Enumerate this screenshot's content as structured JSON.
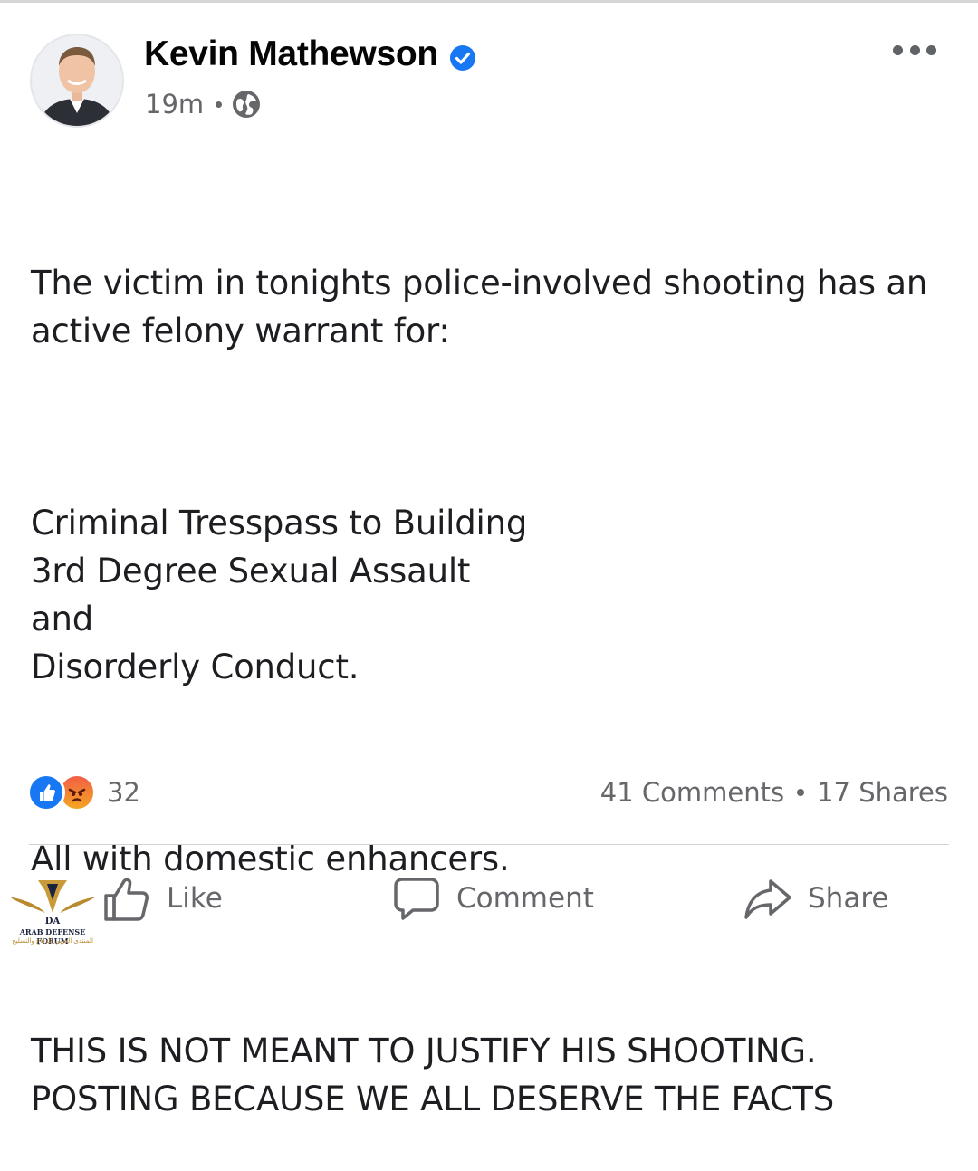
{
  "post": {
    "author_name": "Kevin Mathewson",
    "timestamp": "19m",
    "privacy_icon": "globe-icon",
    "verified_icon": "verified-badge-icon",
    "more_icon": "more-options-icon",
    "body_paragraphs": [
      "The victim in tonights police-involved shooting has an active felony warrant for:",
      "Criminal Tresspass to Building\n3rd Degree Sexual Assault\nand\nDisorderly Conduct.",
      "All with domestic enhancers.",
      "THIS IS NOT MEANT TO JUSTIFY HIS SHOOTING.\nPOSTING BECAUSE WE ALL DESERVE THE FACTS"
    ]
  },
  "engagement": {
    "reaction_icons": [
      "like-reaction-icon",
      "angry-reaction-icon"
    ],
    "reaction_count": "32",
    "comments_label": "41 Comments",
    "shares_label": "17 Shares"
  },
  "actions": {
    "like_label": "Like",
    "comment_label": "Comment",
    "share_label": "Share"
  },
  "watermark": {
    "logo_text": "DA",
    "line1": "ARAB DEFENSE FORUM",
    "line2": "المنتدى العربي للدفاع والتسليح"
  },
  "colors": {
    "accent_blue": "#1877f2",
    "secondary_text": "#65676b",
    "angry_orange": "#f5a623"
  }
}
